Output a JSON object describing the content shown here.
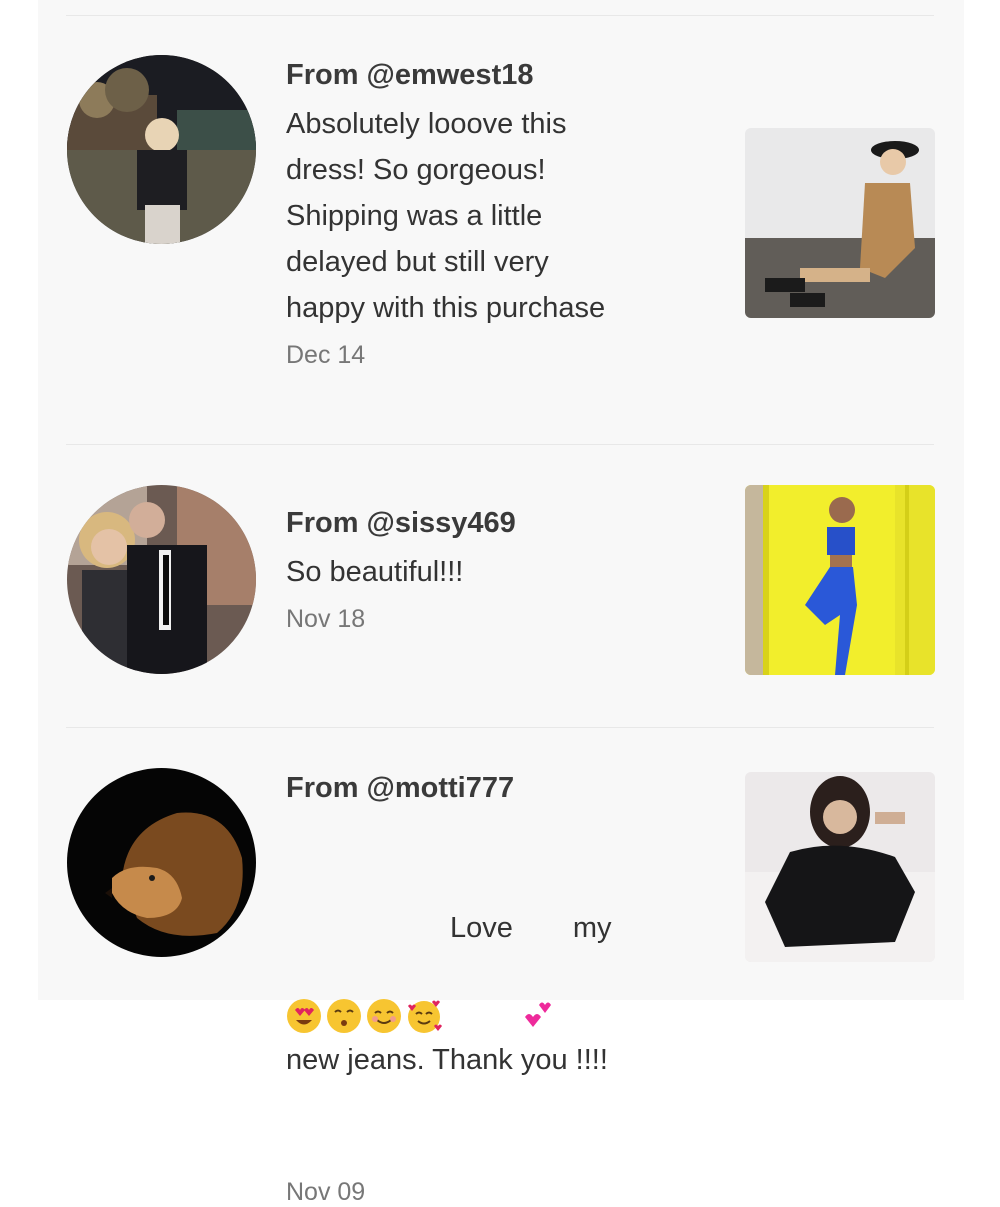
{
  "reviews": [
    {
      "from": "From @emwest18",
      "text": "Absolutely looove this\ndress! So gorgeous!\nShipping was a little\ndelayed but still very\nhappy with this purchase",
      "date": "Dec 14"
    },
    {
      "from": "From @sissy469",
      "text": "So beautiful!!!",
      "date": "Nov 18"
    },
    {
      "from": "From @motti777",
      "text_part1": "Love",
      "text_part2": "my",
      "text_line2": "new jeans. Thank you !!!!",
      "date": "Nov 09",
      "emojis": [
        "heart-eyes-emoji",
        "kissing-emoji",
        "smiling-emoji",
        "smiling-hearts-emoji"
      ],
      "inline_emoji": "two-hearts-emoji"
    }
  ],
  "colors": {
    "panel_bg": "#f8f8f8",
    "divider": "#e8e8e8",
    "text": "#333333",
    "date": "#777777"
  }
}
